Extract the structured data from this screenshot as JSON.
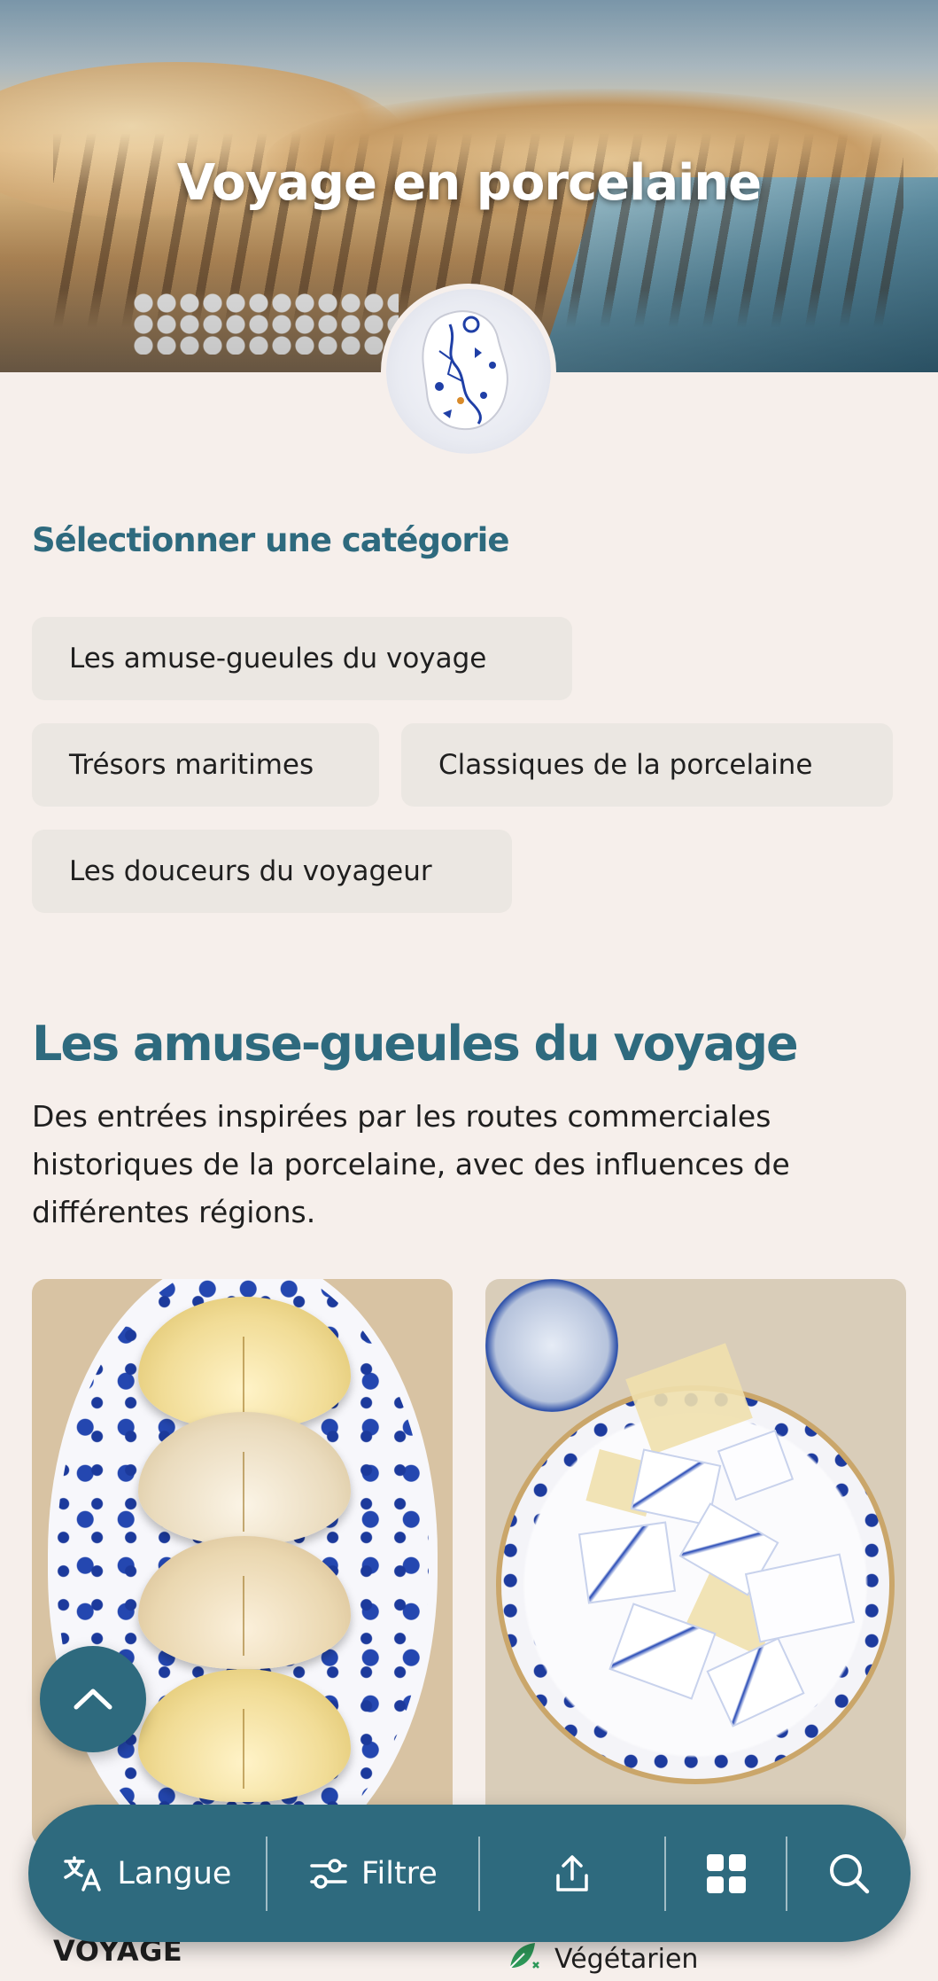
{
  "hero": {
    "title": "Voyage en porcelaine"
  },
  "categories": {
    "heading": "Sélectionner une catégorie",
    "items": [
      {
        "label": "Les amuse-gueules du voyage"
      },
      {
        "label": "Trésors maritimes"
      },
      {
        "label": "Classiques de la porcelaine"
      },
      {
        "label": "Les douceurs du voyageur"
      }
    ]
  },
  "section": {
    "title": "Les amuse-gueules du voyage",
    "description": "Des entrées inspirées par les routes commerciales historiques de la porcelaine, avec des influences de différentes régions."
  },
  "cards": [
    {
      "image": "dumplings-on-blue-porcelain-plate",
      "caption": "VOYAGE"
    },
    {
      "image": "porcelain-shards-on-blue-plate",
      "tag": "Végétarien",
      "tag_icon": "leaf-icon"
    }
  ],
  "bottom_bar": {
    "language_label": "Langue",
    "filter_label": "Filtre",
    "share_icon": "share-icon",
    "grid_icon": "grid-icon",
    "search_icon": "search-icon"
  },
  "colors": {
    "accent": "#2e6a7e",
    "background": "#f6efeb",
    "chip": "#ebe7e2",
    "leaf": "#2e9a5a"
  }
}
